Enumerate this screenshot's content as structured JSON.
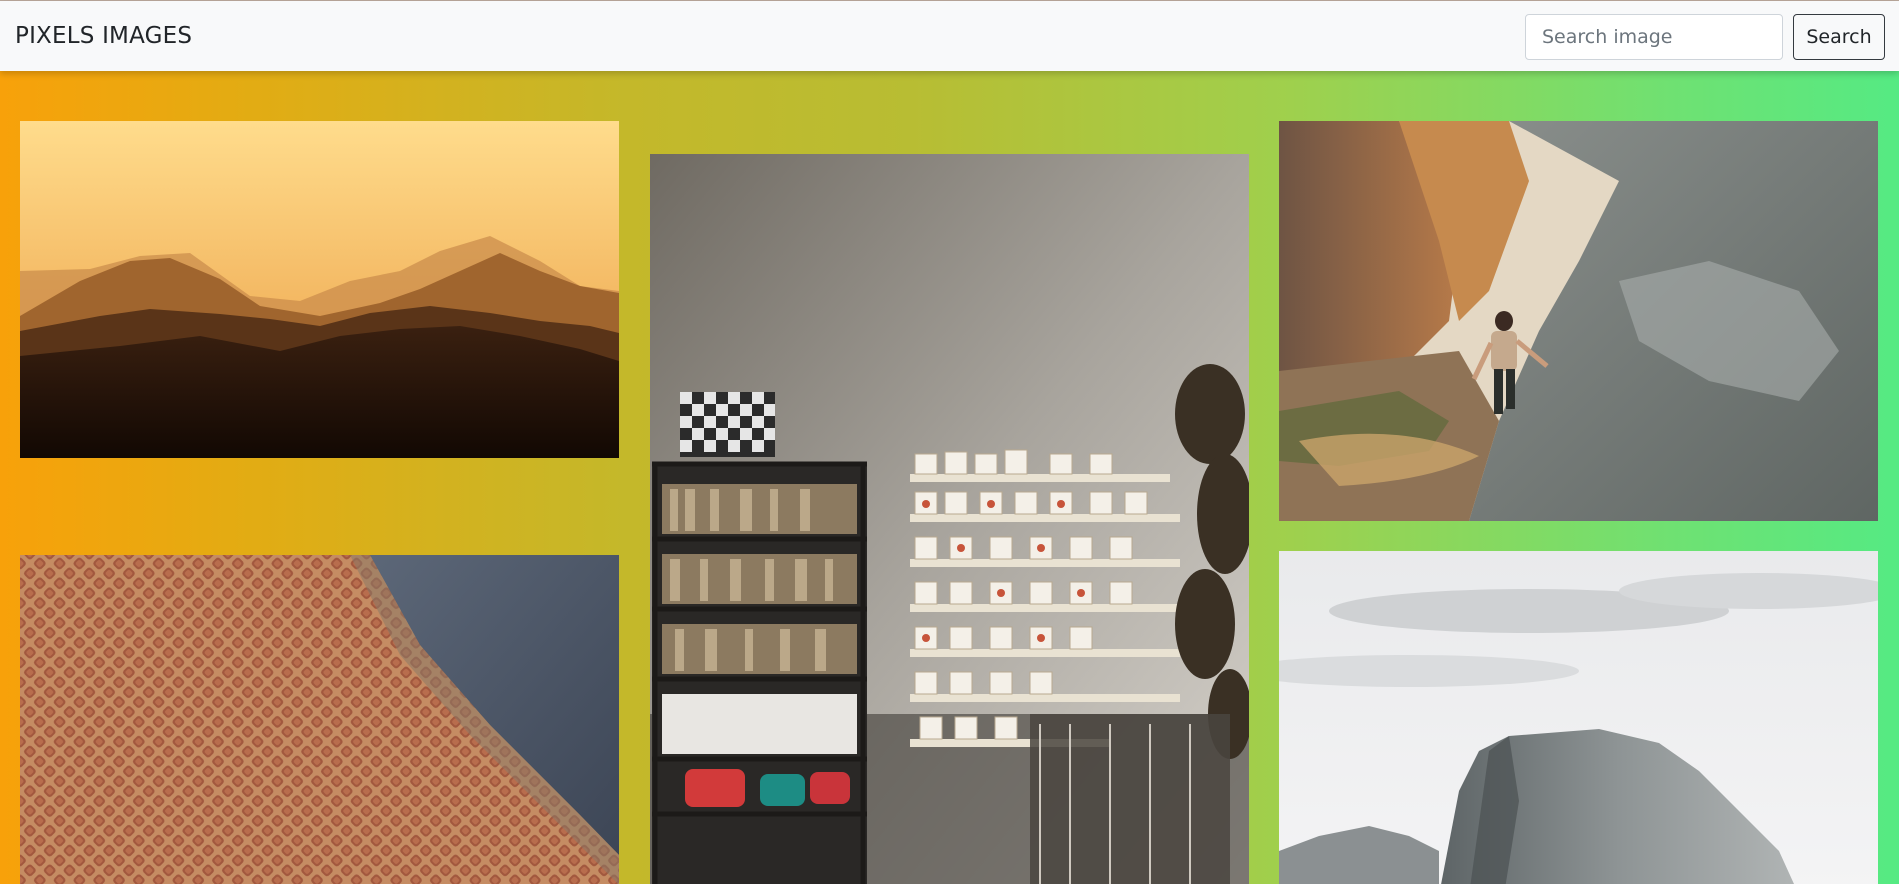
{
  "navbar": {
    "brand": "PIXELS IMAGES",
    "search_placeholder": "Search image",
    "search_value": "",
    "search_button": "Search"
  },
  "gallery": {
    "background_gradient": [
      "#f8a10a",
      "#b8bd33",
      "#55ea83"
    ],
    "images": [
      {
        "subject": "mountain-silhouette-sunset"
      },
      {
        "subject": "shop-interior-shelves"
      },
      {
        "subject": "hiker-canyon-rocks"
      },
      {
        "subject": "textile-fabric-closeup"
      },
      {
        "subject": "half-dome-granite-cliff"
      }
    ]
  }
}
